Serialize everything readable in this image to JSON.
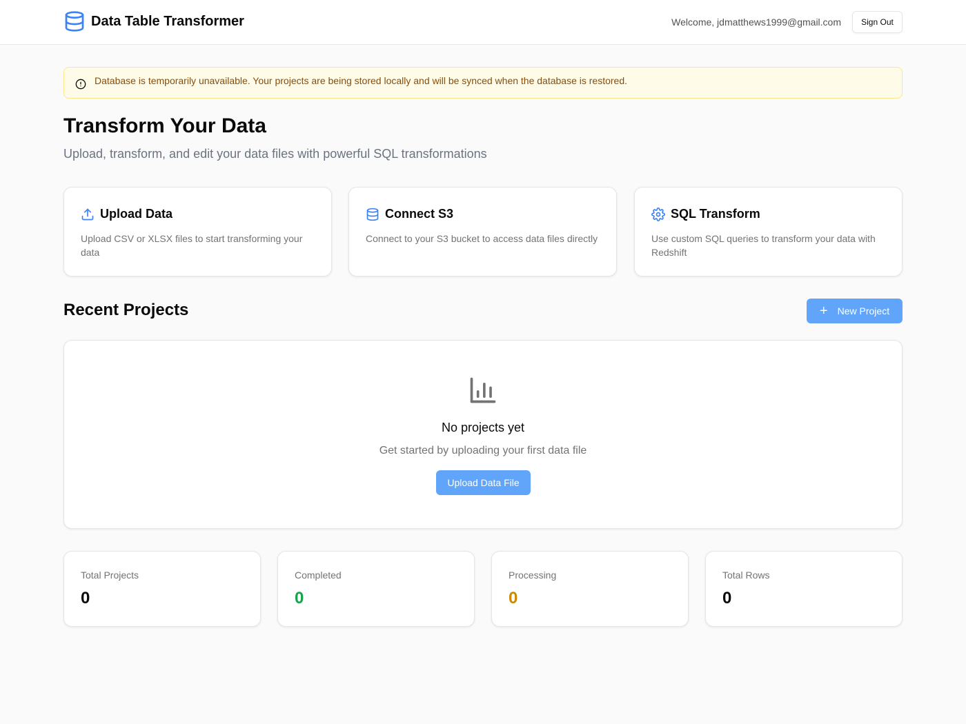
{
  "header": {
    "title": "Data Table Transformer",
    "welcome": "Welcome, jdmatthews1999@gmail.com",
    "sign_out": "Sign Out"
  },
  "alert": {
    "message": "Database is temporarily unavailable. Your projects are being stored locally and will be synced when the database is restored.",
    "icon": "alert-circle-icon"
  },
  "hero": {
    "title": "Transform Your Data",
    "subtitle": "Upload, transform, and edit your data files with powerful SQL transformations"
  },
  "features": [
    {
      "icon": "upload-icon",
      "title": "Upload Data",
      "description": "Upload CSV or XLSX files to start transforming your data"
    },
    {
      "icon": "database-icon",
      "title": "Connect S3",
      "description": "Connect to your S3 bucket to access data files directly"
    },
    {
      "icon": "gear-icon",
      "title": "SQL Transform",
      "description": "Use custom SQL queries to transform your data with Redshift"
    }
  ],
  "recent": {
    "title": "Recent Projects",
    "new_button": "New Project",
    "empty_title": "No projects yet",
    "empty_subtitle": "Get started by uploading your first data file",
    "upload_button": "Upload Data File"
  },
  "stats": [
    {
      "label": "Total Projects",
      "value": "0",
      "color": "#0a0a0a"
    },
    {
      "label": "Completed",
      "value": "0",
      "color": "#16a34a"
    },
    {
      "label": "Processing",
      "value": "0",
      "color": "#ca8a04"
    },
    {
      "label": "Total Rows",
      "value": "0",
      "color": "#0a0a0a"
    }
  ],
  "colors": {
    "accent": "#60a5fa",
    "alert_bg": "#fefce8",
    "alert_text": "#854d0e"
  }
}
